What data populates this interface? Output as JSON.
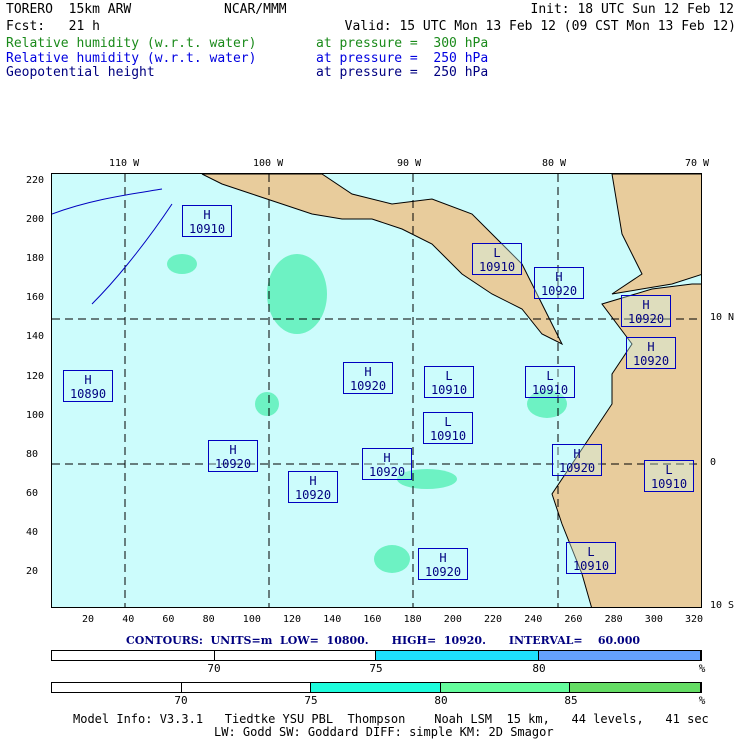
{
  "header": {
    "model": "TORERO  15km ARW",
    "org": "NCAR/MMM",
    "init": "Init: 18 UTC Sun 12 Feb 12",
    "fcst": "Fcst:   21 h",
    "valid": "Valid: 15 UTC Mon 13 Feb 12 (09 CST Mon 13 Feb 12)"
  },
  "fields": [
    {
      "name": "Relative humidity (w.r.t. water)",
      "level": "at pressure =  300 hPa",
      "color": "#1a8a1a"
    },
    {
      "name": "Relative humidity (w.r.t. water)",
      "level": "at pressure =  250 hPa",
      "color": "#0000e0"
    },
    {
      "name": "Geopotential height",
      "level": "at pressure =  250 hPa",
      "color": "#000080"
    }
  ],
  "axes": {
    "top": [
      "110 W",
      "100 W",
      "90 W",
      "80 W",
      "70 W"
    ],
    "right": [
      "10 N",
      "0",
      "10 S"
    ],
    "left": [
      "220",
      "200",
      "180",
      "160",
      "140",
      "120",
      "100",
      "80",
      "60",
      "40",
      "20"
    ],
    "bottom": [
      "20",
      "40",
      "60",
      "80",
      "100",
      "120",
      "140",
      "160",
      "180",
      "200",
      "220",
      "240",
      "260",
      "280",
      "300",
      "320"
    ]
  },
  "centers": [
    {
      "t": "H",
      "v": "10910"
    },
    {
      "t": "L",
      "v": "10910"
    },
    {
      "t": "H",
      "v": "10920"
    },
    {
      "t": "H",
      "v": "10920"
    },
    {
      "t": "H",
      "v": "10920"
    },
    {
      "t": "H",
      "v": "10890"
    },
    {
      "t": "H",
      "v": "10920"
    },
    {
      "t": "L",
      "v": "10910"
    },
    {
      "t": "L",
      "v": "10910"
    },
    {
      "t": "L",
      "v": "10910"
    },
    {
      "t": "H",
      "v": "10920"
    },
    {
      "t": "H",
      "v": "10920"
    },
    {
      "t": "H",
      "v": "10920"
    },
    {
      "t": "L",
      "v": "10910"
    },
    {
      "t": "H",
      "v": "10920"
    },
    {
      "t": "H",
      "v": "10920"
    },
    {
      "t": "L",
      "v": "10910"
    }
  ],
  "contours": "CONTOURS:  UNITS=m  LOW=  10800.      HIGH=  10920.      INTERVAL=    60.000",
  "bar1": {
    "labels": [
      "70",
      "75",
      "80",
      "%"
    ],
    "colors": [
      "#ffffff",
      "#ffffff",
      "#1ee0fc",
      "#64a0fc"
    ]
  },
  "bar2": {
    "labels": [
      "70",
      "75",
      "80",
      "85",
      "%"
    ],
    "colors": [
      "#ffffff",
      "#ffffff",
      "#1efcdc",
      "#64fc9c",
      "#64dc64"
    ]
  },
  "footer": {
    "line1": "Model Info: V3.3.1   Tiedtke YSU PBL  Thompson    Noah LSM  15 km,   44 levels,   41 sec",
    "line2": "LW: Godd SW: Goddard DIFF: simple KM: 2D Smagor"
  }
}
